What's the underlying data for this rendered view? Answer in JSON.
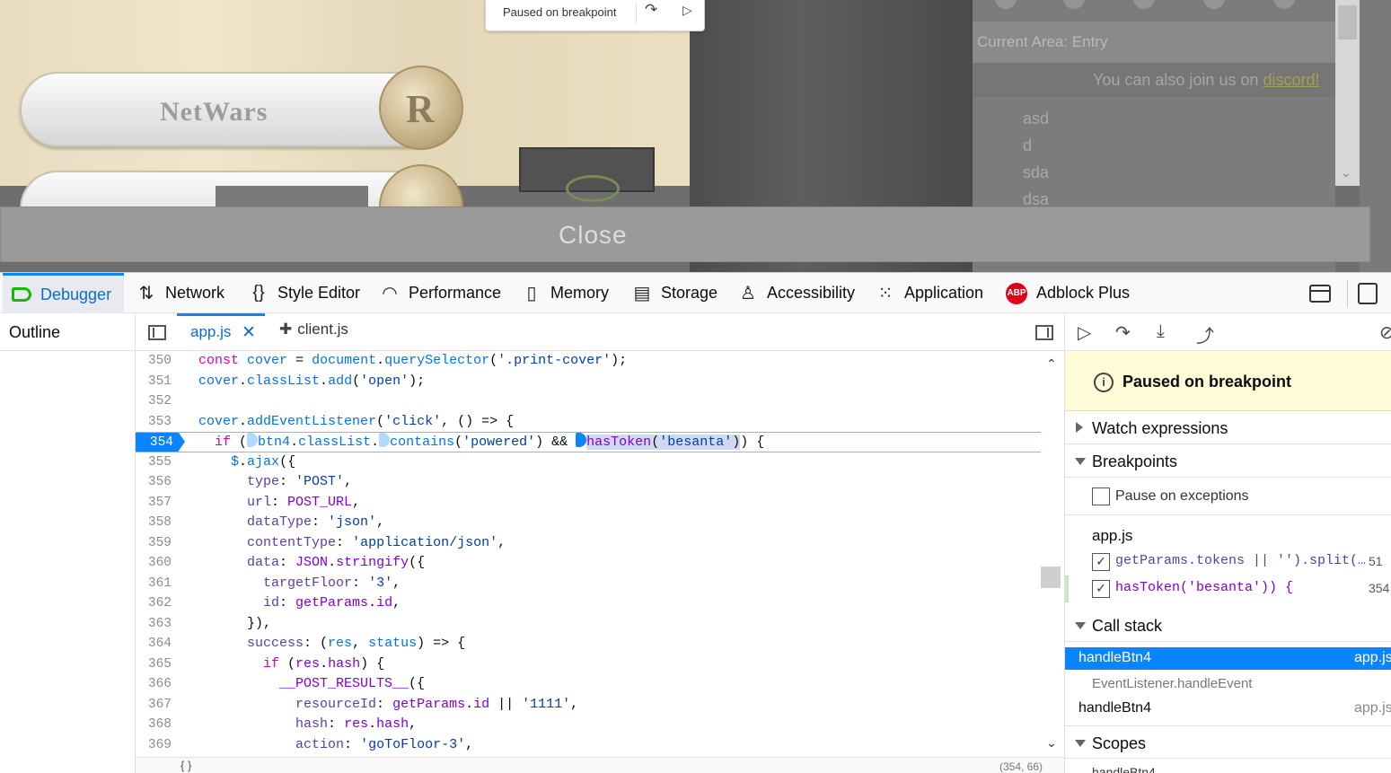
{
  "game": {
    "logo_text": "NetWars",
    "coin_letter": "R",
    "chat_area": "Current Area: Entry",
    "join_prefix": "You can also join us on ",
    "join_link": "discord!",
    "messages": [
      "asd",
      "d",
      "sda",
      "dsa"
    ],
    "close_label": "Close"
  },
  "paused_overlay": {
    "text": "Paused on breakpoint",
    "step_icon": "step-over-icon",
    "resume_icon": "resume-icon"
  },
  "devtools_tabs": [
    {
      "label": "Debugger",
      "icon": "debugger-icon"
    },
    {
      "label": "Network",
      "icon": "network-icon"
    },
    {
      "label": "Style Editor",
      "icon": "style-editor-icon"
    },
    {
      "label": "Performance",
      "icon": "performance-icon"
    },
    {
      "label": "Memory",
      "icon": "memory-icon"
    },
    {
      "label": "Storage",
      "icon": "storage-icon"
    },
    {
      "label": "Accessibility",
      "icon": "accessibility-icon"
    },
    {
      "label": "Application",
      "icon": "application-icon"
    },
    {
      "label": "Adblock Plus",
      "icon": "adblock-icon",
      "badge": "ABP"
    }
  ],
  "outline": {
    "title": "Outline"
  },
  "editor": {
    "tabs": [
      {
        "label": "app.js",
        "active": true
      },
      {
        "label": "client.js",
        "active": false
      }
    ],
    "current_line": 354,
    "lines": [
      {
        "n": "350",
        "code": "const cover = document.querySelector('.print-cover');"
      },
      {
        "n": "351",
        "code": "cover.classList.add('open');"
      },
      {
        "n": "352",
        "code": ""
      },
      {
        "n": "353",
        "code": "cover.addEventListener('click', () => {"
      },
      {
        "n": "354",
        "code": "  if (btn4.classList.contains('powered') && hasToken('besanta')) {"
      },
      {
        "n": "355",
        "code": "    $.ajax({"
      },
      {
        "n": "356",
        "code": "      type: 'POST',"
      },
      {
        "n": "357",
        "code": "      url: POST_URL,"
      },
      {
        "n": "358",
        "code": "      dataType: 'json',"
      },
      {
        "n": "359",
        "code": "      contentType: 'application/json',"
      },
      {
        "n": "360",
        "code": "      data: JSON.stringify({"
      },
      {
        "n": "361",
        "code": "        targetFloor: '3',"
      },
      {
        "n": "362",
        "code": "        id: getParams.id,"
      },
      {
        "n": "363",
        "code": "      }),"
      },
      {
        "n": "364",
        "code": "      success: (res, status) => {"
      },
      {
        "n": "365",
        "code": "        if (res.hash) {"
      },
      {
        "n": "366",
        "code": "          __POST_RESULTS__({"
      },
      {
        "n": "367",
        "code": "            resourceId: getParams.id || '1111',"
      },
      {
        "n": "368",
        "code": "            hash: res.hash,"
      },
      {
        "n": "369",
        "code": "            action: 'goToFloor-3',"
      }
    ],
    "footer_brace": "{ }",
    "footer_position": "(354, 66)"
  },
  "right_pane": {
    "paused_banner": "Paused on breakpoint",
    "watch_expressions": "Watch expressions",
    "breakpoints": "Breakpoints",
    "pause_on_exceptions": "Pause on exceptions",
    "bp_file": "app.js",
    "bp_items": [
      {
        "text": "getParams.tokens || '').split(…",
        "line": "51",
        "checked": true
      },
      {
        "text": "hasToken('besanta')) {",
        "line": "354",
        "checked": true
      }
    ],
    "call_stack": "Call stack",
    "frames": [
      {
        "name": "handleBtn4",
        "file": "app.js",
        "selected": true
      },
      {
        "name": "handleBtn4",
        "file": "app.js",
        "selected": false
      }
    ],
    "event_listener": "EventListener.handleEvent",
    "scopes": "Scopes",
    "scopes_next": "handleBtn4"
  }
}
